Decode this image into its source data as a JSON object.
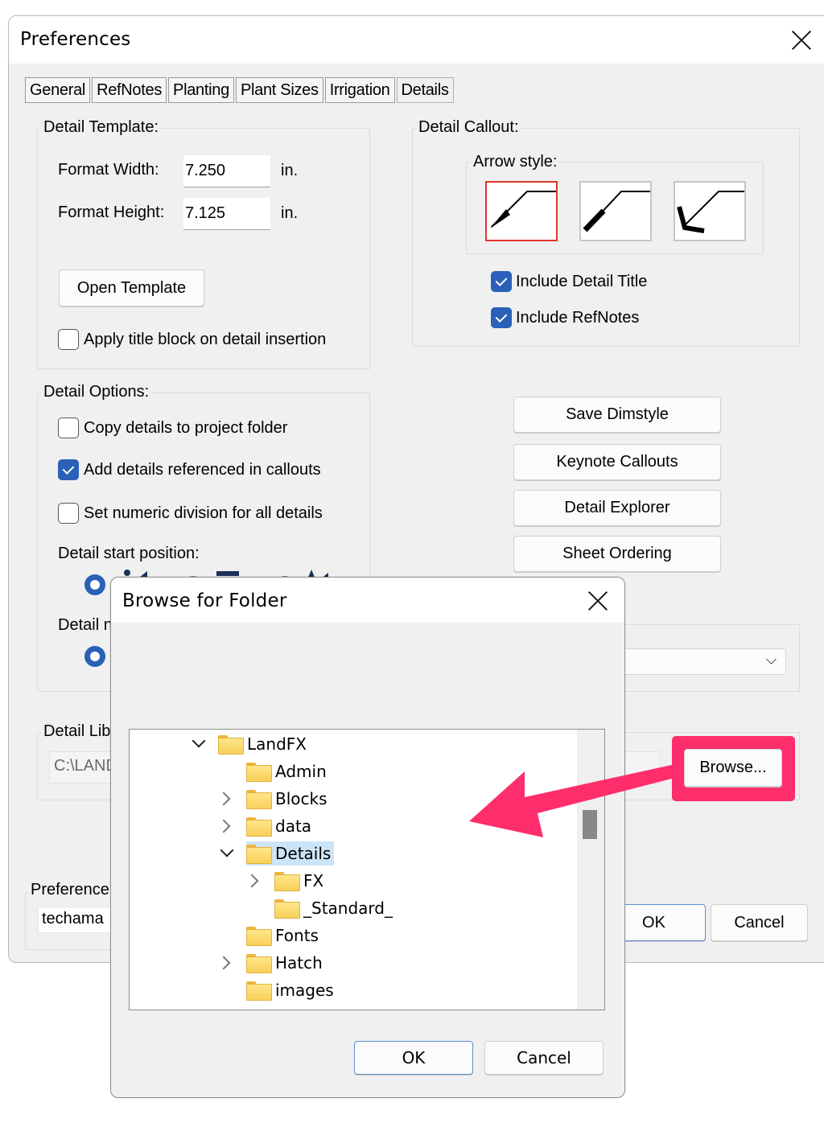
{
  "preferences": {
    "title": "Preferences",
    "tabs": [
      {
        "label": "General",
        "active": false
      },
      {
        "label": "RefNotes",
        "active": false
      },
      {
        "label": "Planting",
        "active": false
      },
      {
        "label": "Plant Sizes",
        "active": false
      },
      {
        "label": "Irrigation",
        "active": false
      },
      {
        "label": "Details",
        "active": true
      }
    ],
    "detail_template": {
      "label": "Detail Template:",
      "format_width_label": "Format Width:",
      "format_width_value": "7.250",
      "format_height_label": "Format Height:",
      "format_height_value": "7.125",
      "unit": "in.",
      "open_template_button": "Open Template",
      "apply_title_block": {
        "label": "Apply title block on detail insertion",
        "checked": false
      }
    },
    "detail_callout": {
      "label": "Detail Callout:",
      "arrow_style_label": "Arrow style:",
      "arrow_styles": [
        "arrowhead",
        "tick",
        "open-arrow"
      ],
      "selected_arrow_style": "arrowhead",
      "include_detail_title": {
        "label": "Include Detail Title",
        "checked": true
      },
      "include_refnotes": {
        "label": "Include RefNotes",
        "checked": true
      }
    },
    "detail_options": {
      "label": "Detail Options:",
      "copy_details": {
        "label": "Copy details to project folder",
        "checked": false
      },
      "add_details_referenced": {
        "label": "Add details referenced in callouts",
        "checked": true
      },
      "set_numeric_division": {
        "label": "Set numeric division for all details",
        "checked": false
      },
      "start_position_label": "Detail start position:",
      "detail_n_label": "Detail n"
    },
    "side_buttons": [
      "Save Dimstyle",
      "Keynote Callouts",
      "Detail Explorer",
      "Sheet Ordering"
    ],
    "detail_library": {
      "label": "Detail Lib",
      "path": "C:\\LAND",
      "browse_button": "Browse..."
    },
    "preference_set": {
      "label": "Preference",
      "value": "techama"
    },
    "ok_button": "OK",
    "cancel_button": "Cancel"
  },
  "browse_dialog": {
    "title": "Browse for Folder",
    "tree": [
      {
        "name": "LandFX",
        "level": 0,
        "expander": "down",
        "selected": false
      },
      {
        "name": "Admin",
        "level": 1,
        "expander": "none",
        "selected": false
      },
      {
        "name": "Blocks",
        "level": 1,
        "expander": "right",
        "selected": false
      },
      {
        "name": "data",
        "level": 1,
        "expander": "right",
        "selected": false
      },
      {
        "name": "Details",
        "level": 1,
        "expander": "down",
        "selected": true
      },
      {
        "name": "FX",
        "level": 2,
        "expander": "right",
        "selected": false
      },
      {
        "name": "_Standard_",
        "level": 2,
        "expander": "none",
        "selected": false
      },
      {
        "name": "Fonts",
        "level": 1,
        "expander": "none",
        "selected": false
      },
      {
        "name": "Hatch",
        "level": 1,
        "expander": "right",
        "selected": false
      },
      {
        "name": "images",
        "level": 1,
        "expander": "none",
        "selected": false
      }
    ],
    "ok_button": "OK",
    "cancel_button": "Cancel"
  },
  "annotation": {
    "highlight_color": "#fe2d6b",
    "target": "Browse..."
  }
}
